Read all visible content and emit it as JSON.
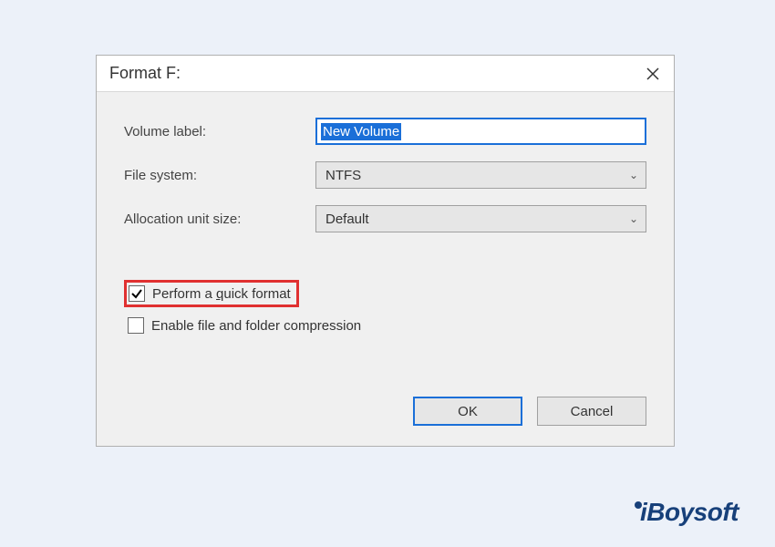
{
  "dialog": {
    "title": "Format F:",
    "fields": {
      "volume_label": {
        "label": "Volume label:",
        "value": "New Volume"
      },
      "file_system": {
        "label": "File system:",
        "value": "NTFS"
      },
      "allocation": {
        "label": "Allocation unit size:",
        "value": "Default"
      }
    },
    "checkboxes": {
      "quick_format": {
        "label_pre": "Perform a ",
        "label_u": "q",
        "label_post": "uick format",
        "checked": true
      },
      "compression": {
        "label": "Enable file and folder compression",
        "checked": false
      }
    },
    "buttons": {
      "ok": "OK",
      "cancel": "Cancel"
    }
  },
  "watermark": "iBoysoft"
}
